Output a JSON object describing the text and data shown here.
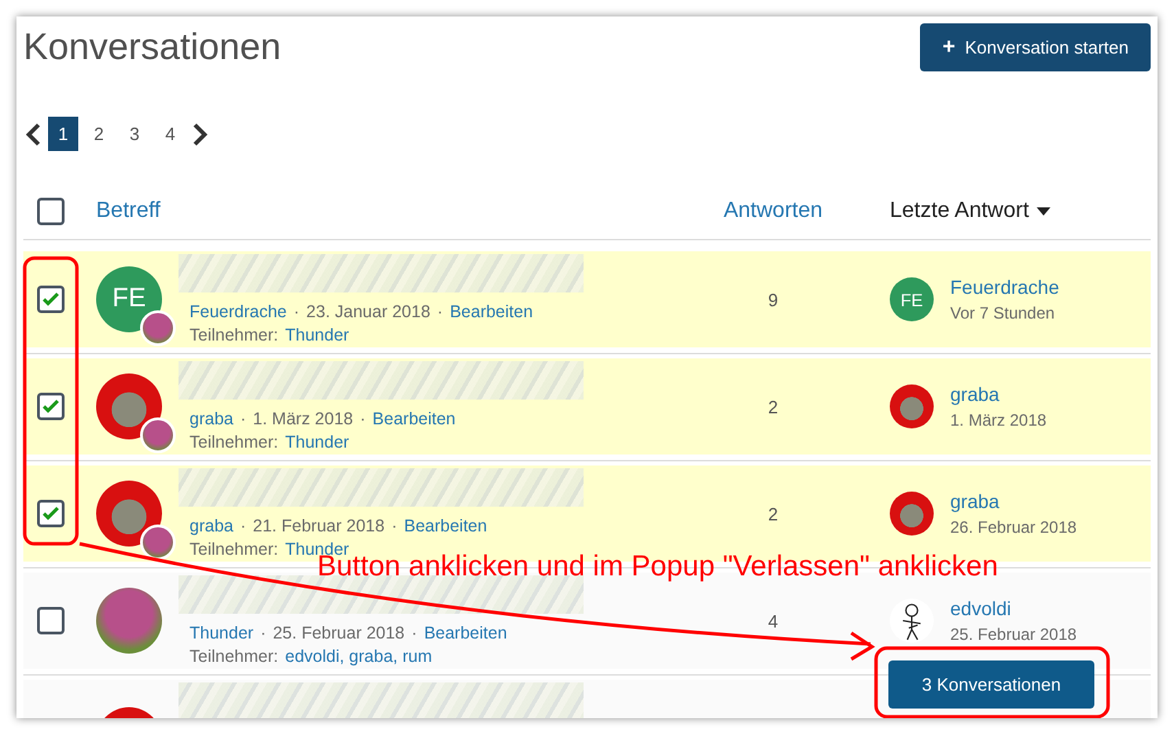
{
  "title": "Konversationen",
  "start_button": {
    "icon": "+",
    "label": "Konversation starten"
  },
  "pagination": {
    "pages": [
      {
        "label": "1",
        "selected": true
      },
      {
        "label": "2",
        "selected": false
      },
      {
        "label": "3",
        "selected": false
      },
      {
        "label": "4",
        "selected": false
      }
    ]
  },
  "meta_separator": "·",
  "table": {
    "select_all": {
      "checked": false
    },
    "columns": [
      {
        "label": "Betreff",
        "sorted": false
      },
      {
        "label": "Antworten",
        "sorted": false
      },
      {
        "label": "Letzte Antwort",
        "sorted": true
      }
    ],
    "rows": [
      {
        "checked": true,
        "participant_badge": true,
        "avatar": {
          "kind": "initials",
          "text": "FE"
        },
        "author": "Feuerdrache",
        "date": "23. Januar 2018",
        "edit": "Bearbeiten",
        "participants_label": "Teilnehmer:",
        "participants": "Thunder",
        "replies": "9",
        "last_reply": {
          "avatar": {
            "kind": "initials",
            "text": "FE"
          },
          "name": "Feuerdrache",
          "time": "Vor 7 Stunden"
        }
      },
      {
        "checked": true,
        "participant_badge": true,
        "avatar": {
          "kind": "photo"
        },
        "author": "graba",
        "date": "1. März 2018",
        "edit": "Bearbeiten",
        "participants_label": "Teilnehmer:",
        "participants": "Thunder",
        "replies": "2",
        "last_reply": {
          "avatar": {
            "kind": "photo"
          },
          "name": "graba",
          "time": "1. März 2018"
        }
      },
      {
        "checked": true,
        "participant_badge": true,
        "avatar": {
          "kind": "photo"
        },
        "author": "graba",
        "date": "21. Februar 2018",
        "edit": "Bearbeiten",
        "participants_label": "Teilnehmer:",
        "participants": "Thunder",
        "replies": "2",
        "last_reply": {
          "avatar": {
            "kind": "photo"
          },
          "name": "graba",
          "time": "26. Februar 2018"
        }
      },
      {
        "checked": false,
        "participant_badge": false,
        "avatar": {
          "kind": "tree_photo"
        },
        "author": "Thunder",
        "date": "25. Februar 2018",
        "edit": "Bearbeiten",
        "participants_label": "Teilnehmer:",
        "participants": "edvoldi, graba, rum",
        "replies": "4",
        "last_reply": {
          "avatar": {
            "kind": "drawing"
          },
          "name": "edvoldi",
          "time": "25. Februar 2018"
        }
      }
    ],
    "partial_row": {
      "avatar": {
        "kind": "photo"
      }
    }
  },
  "selection_bar": {
    "button": "3 Konversationen"
  },
  "annotation": {
    "text": "Button anklicken und im Popup \"Verlassen\" anklicken"
  }
}
